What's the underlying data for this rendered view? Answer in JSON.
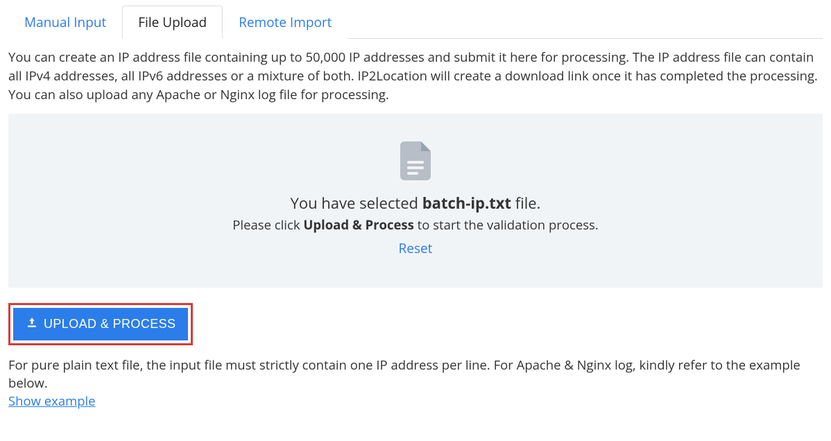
{
  "tabs": {
    "manual": "Manual Input",
    "file": "File Upload",
    "remote": "Remote Import"
  },
  "intro": "You can create an IP address file containing up to 50,000 IP addresses and submit it here for processing. The IP address file can contain all IPv4 addresses, all IPv6 addresses or a mixture of both. IP2Location will create a download link once it has completed the processing. You can also upload any Apache or Nginx log file for processing.",
  "dropzone": {
    "selected_pre": "You have selected ",
    "selected_file": "batch-ip.txt",
    "selected_post": " file.",
    "instruct_pre": "Please click ",
    "instruct_btn": "Upload & Process",
    "instruct_post": " to start the validation process.",
    "reset": "Reset"
  },
  "upload_btn": "UPLOAD & PROCESS",
  "note": "For pure plain text file, the input file must strictly contain one IP address per line. For Apache & Nginx log, kindly refer to the example below.",
  "show_example": "Show example"
}
